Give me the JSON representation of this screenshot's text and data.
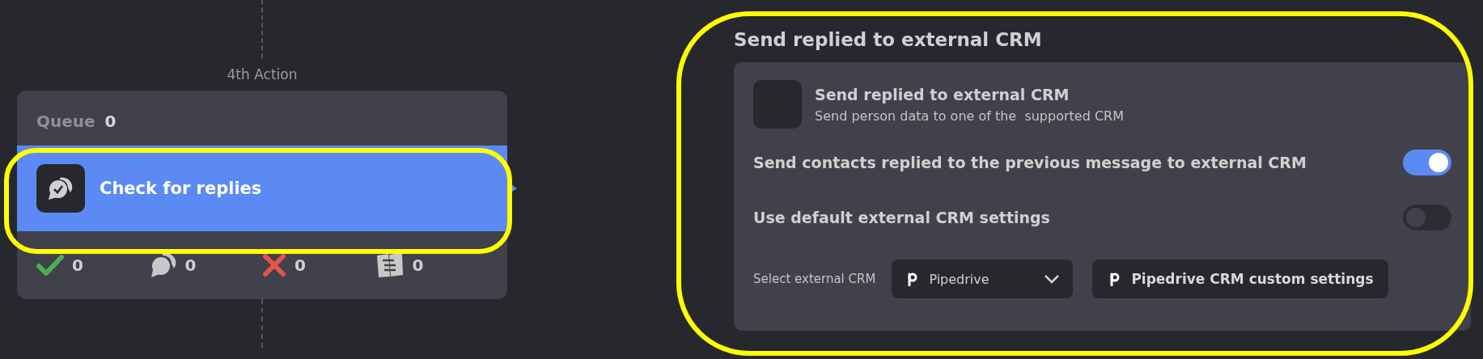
{
  "node": {
    "step_label": "4th Action",
    "queue": {
      "label": "Queue",
      "count": "0"
    },
    "action": {
      "title": "Check for replies"
    },
    "stats": [
      {
        "kind": "success",
        "count": "0"
      },
      {
        "kind": "replies",
        "count": "0"
      },
      {
        "kind": "failed",
        "count": "0"
      },
      {
        "kind": "skipped",
        "count": "0"
      }
    ]
  },
  "panel": {
    "title": "Send replied to external CRM",
    "card": {
      "title": "Send replied to external CRM",
      "description": "Send person data to one of the  supported CRM"
    },
    "settings": [
      {
        "label": "Send contacts replied to the previous message to external CRM",
        "on": true
      },
      {
        "label": "Use default external CRM settings",
        "on": false
      }
    ],
    "crm": {
      "label": "Select external CRM",
      "value": "Pipedrive",
      "button": "Pipedrive CRM custom settings"
    }
  }
}
